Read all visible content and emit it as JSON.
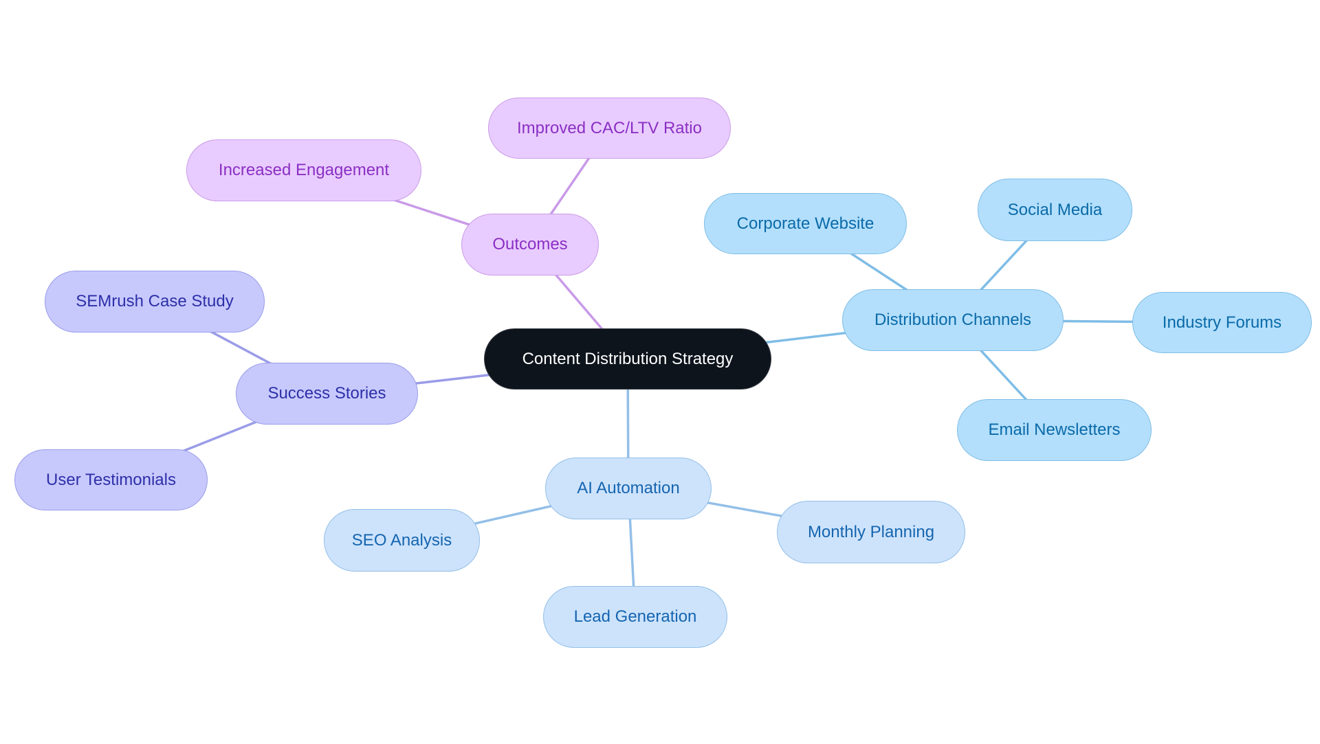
{
  "diagram": {
    "type": "mindmap",
    "root": {
      "id": "root",
      "label": "Content Distribution Strategy"
    },
    "branches": [
      {
        "id": "outcomes",
        "label": "Outcomes",
        "theme": "purple",
        "edge_color": "#c99ae8",
        "children": [
          {
            "id": "cac-ltv",
            "label": "Improved CAC/LTV Ratio"
          },
          {
            "id": "engagement",
            "label": "Increased Engagement"
          }
        ]
      },
      {
        "id": "distribution",
        "label": "Distribution Channels",
        "theme": "sky",
        "edge_color": "#7fbde6",
        "children": [
          {
            "id": "corporate-website",
            "label": "Corporate Website"
          },
          {
            "id": "social-media",
            "label": "Social Media"
          },
          {
            "id": "industry-forums",
            "label": "Industry Forums"
          },
          {
            "id": "email-newsletters",
            "label": "Email Newsletters"
          }
        ]
      },
      {
        "id": "ai-automation",
        "label": "AI Automation",
        "theme": "pale",
        "edge_color": "#93bfe8",
        "children": [
          {
            "id": "seo-analysis",
            "label": "SEO Analysis"
          },
          {
            "id": "monthly-planning",
            "label": "Monthly Planning"
          },
          {
            "id": "lead-generation",
            "label": "Lead Generation"
          }
        ]
      },
      {
        "id": "success-stories",
        "label": "Success Stories",
        "theme": "indigo",
        "edge_color": "#9a9ce8",
        "children": [
          {
            "id": "semrush",
            "label": "SEMrush Case Study"
          },
          {
            "id": "testimonials",
            "label": "User Testimonials"
          }
        ]
      }
    ],
    "colors": {
      "root_fill": "#0d141c",
      "purple_fill": "#e9ccff",
      "indigo_fill": "#c7c9fd",
      "sky_fill": "#b3dffc",
      "pale_fill": "#cde3fb"
    }
  }
}
